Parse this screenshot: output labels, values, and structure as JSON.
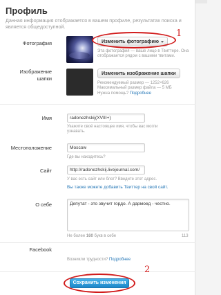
{
  "header": {
    "title": "Профиль",
    "subtitle": "Данная информация отображается в вашем профиле, результатах поиска и является общедоступной."
  },
  "photo": {
    "label": "Фотография",
    "button": "Изменить фотографию",
    "help": [
      "Эта фотография — ваше лицо в Твиттере. Она отображается рядом с вашими твитами."
    ]
  },
  "header_image": {
    "label_line1": "Изображение",
    "label_line2": "шапки",
    "button": "Изменить изображение шапки",
    "help_line1": "Рекомендуемый размер — 1252×626",
    "help_line2": "Максимальный размер файла — 5 МБ",
    "help_line3": "Нужна помощь?",
    "help_link": "Подробнее"
  },
  "name": {
    "label": "Имя",
    "value": "radonezhskij(XVIII+)",
    "help_line1": "Укажите своё настоящее имя, чтобы вас могли",
    "help_line2": "узнавать."
  },
  "location": {
    "label": "Местоположение",
    "value": "Moscow",
    "help": "Где вы находитесь?"
  },
  "website": {
    "label": "Сайт",
    "value": "http://radonezhskij.livejournal.com/",
    "help": "У вас есть сайт или блог? Введите этот адрес.",
    "link": "Вы также можете добавить Твиттер на свой сайт."
  },
  "bio": {
    "label": "О себе",
    "value": "Депутат - это звучит гордо. А дармоед - честно.",
    "help_prefix": "Не более ",
    "help_count": "160",
    "help_suffix": " букв в себе",
    "counter": "113"
  },
  "facebook": {
    "label": "Facebook",
    "help": "Возникли трудности?",
    "link": "Подробнее"
  },
  "save_button": "Сохранить изменения",
  "annotations": {
    "one": "1",
    "two": "2"
  },
  "colors": {
    "link": "#2a7ab8",
    "annotation": "#d11a1a",
    "save": "#1e87c8"
  }
}
